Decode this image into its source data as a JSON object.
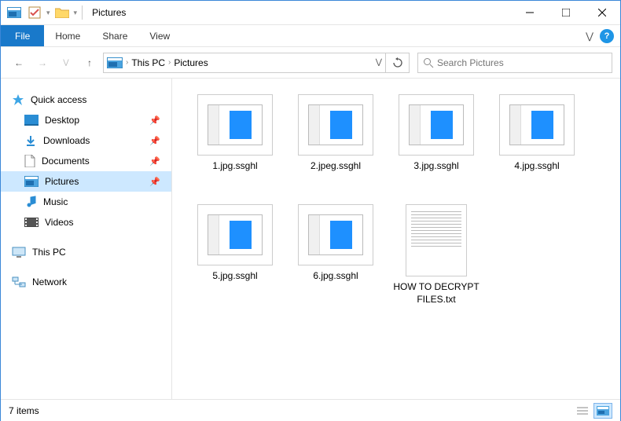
{
  "window": {
    "title": "Pictures"
  },
  "ribbon": {
    "file": "File",
    "tabs": [
      "Home",
      "Share",
      "View"
    ]
  },
  "breadcrumb": {
    "parts": [
      "This PC",
      "Pictures"
    ]
  },
  "search": {
    "placeholder": "Search Pictures"
  },
  "sidebar": {
    "quick_access": "Quick access",
    "items": [
      {
        "label": "Desktop",
        "pinned": true
      },
      {
        "label": "Downloads",
        "pinned": true
      },
      {
        "label": "Documents",
        "pinned": true
      },
      {
        "label": "Pictures",
        "pinned": true,
        "selected": true
      },
      {
        "label": "Music",
        "pinned": false
      },
      {
        "label": "Videos",
        "pinned": false
      }
    ],
    "this_pc": "This PC",
    "network": "Network"
  },
  "files": [
    {
      "name": "1.jpg.ssghl",
      "type": "img"
    },
    {
      "name": "2.jpeg.ssghl",
      "type": "img"
    },
    {
      "name": "3.jpg.ssghl",
      "type": "img"
    },
    {
      "name": "4.jpg.ssghl",
      "type": "img"
    },
    {
      "name": "5.jpg.ssghl",
      "type": "img"
    },
    {
      "name": "6.jpg.ssghl",
      "type": "img"
    },
    {
      "name": "HOW TO DECRYPT FILES.txt",
      "type": "txt"
    }
  ],
  "status": {
    "count": "7 items"
  }
}
